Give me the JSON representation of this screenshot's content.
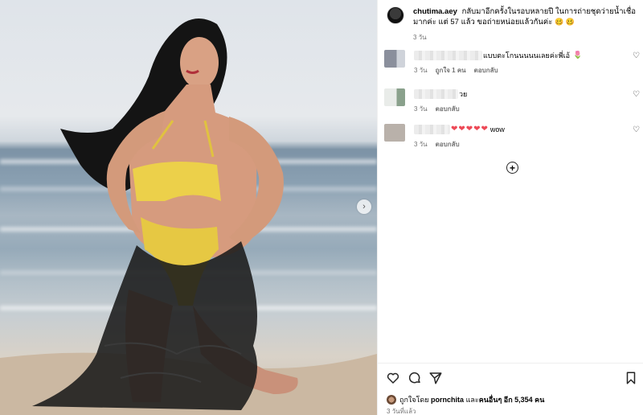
{
  "post": {
    "username": "chutima.aey",
    "caption": "กลับมาอีกครั้งในรอบหลายปี ในการถ่ายชุดว่ายน้ำเชื่อมากค่ะ แต่ 57 แล้ว ขอถ่ายหน่อยแล้วกันค่ะ",
    "caption_emoji": "🥴 🥴",
    "time": "3 วัน"
  },
  "comments": [
    {
      "text": "แบบตะโกนนนนนเลยค่ะพี่เอ้",
      "emoji": "🌷",
      "time": "3 วัน",
      "likes": "ถูกใจ 1 คน",
      "reply": "ตอบกลับ"
    },
    {
      "text": "วย",
      "time": "3 วัน",
      "reply": "ตอบกลับ"
    },
    {
      "hearts": "❤❤❤❤❤",
      "text": "wow",
      "time": "3 วัน",
      "reply": "ตอบกลับ"
    }
  ],
  "likes": {
    "prefix": "ถูกใจโดย",
    "user": "pornchita",
    "middle": "และ",
    "others": "คนอื่นๆ อีก 5,354 คน"
  },
  "post_time": "3 วันที่แล้ว",
  "icons": {
    "next": "chevron-right-icon",
    "like": "heart-icon",
    "comment": "comment-icon",
    "share": "share-icon",
    "save": "bookmark-icon",
    "add": "plus-circle-icon"
  },
  "colors": {
    "heart_red": "#ed4956",
    "meta_gray": "#737373"
  }
}
